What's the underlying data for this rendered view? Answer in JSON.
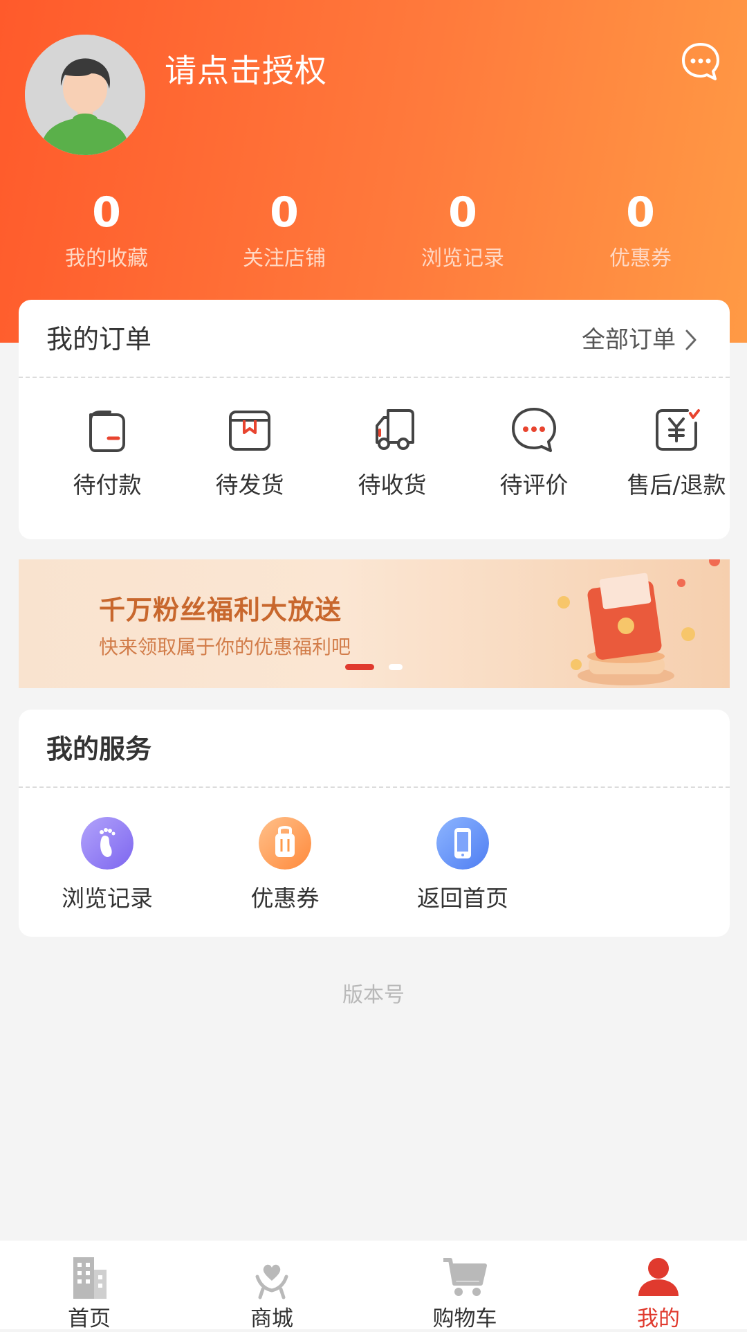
{
  "header": {
    "username": "请点击授权",
    "stats": [
      {
        "value": "0",
        "label": "我的收藏"
      },
      {
        "value": "0",
        "label": "关注店铺"
      },
      {
        "value": "0",
        "label": "浏览记录"
      },
      {
        "value": "0",
        "label": "优惠券"
      }
    ],
    "accent_colors": [
      "#ff5a2b",
      "#ff9a45"
    ]
  },
  "orders": {
    "title": "我的订单",
    "all_link": "全部订单",
    "items": [
      {
        "label": "待付款",
        "icon": "wallet-icon"
      },
      {
        "label": "待发货",
        "icon": "box-icon"
      },
      {
        "label": "待收货",
        "icon": "truck-icon"
      },
      {
        "label": "待评价",
        "icon": "comment-icon"
      },
      {
        "label": "售后/退款",
        "icon": "refund-icon"
      }
    ]
  },
  "banner": {
    "title": "千万粉丝福利大放送",
    "subtitle": "快来领取属于你的优惠福利吧",
    "active_slide": 1,
    "slide_count": 2
  },
  "services": {
    "title": "我的服务",
    "items": [
      {
        "label": "浏览记录",
        "icon": "footprint-icon",
        "color": "#8f7cf4"
      },
      {
        "label": "优惠券",
        "icon": "coupon-bag-icon",
        "color": "#ff9a4a"
      },
      {
        "label": "返回首页",
        "icon": "phone-icon",
        "color": "#5f8ef8"
      }
    ]
  },
  "footer": {
    "version_label": "版本号"
  },
  "tabbar": {
    "items": [
      {
        "label": "首页",
        "icon": "building-icon"
      },
      {
        "label": "商城",
        "icon": "mall-heart-icon"
      },
      {
        "label": "购物车",
        "icon": "cart-icon"
      },
      {
        "label": "我的",
        "icon": "user-icon",
        "active": true
      }
    ],
    "active_color": "#e03a2e"
  }
}
